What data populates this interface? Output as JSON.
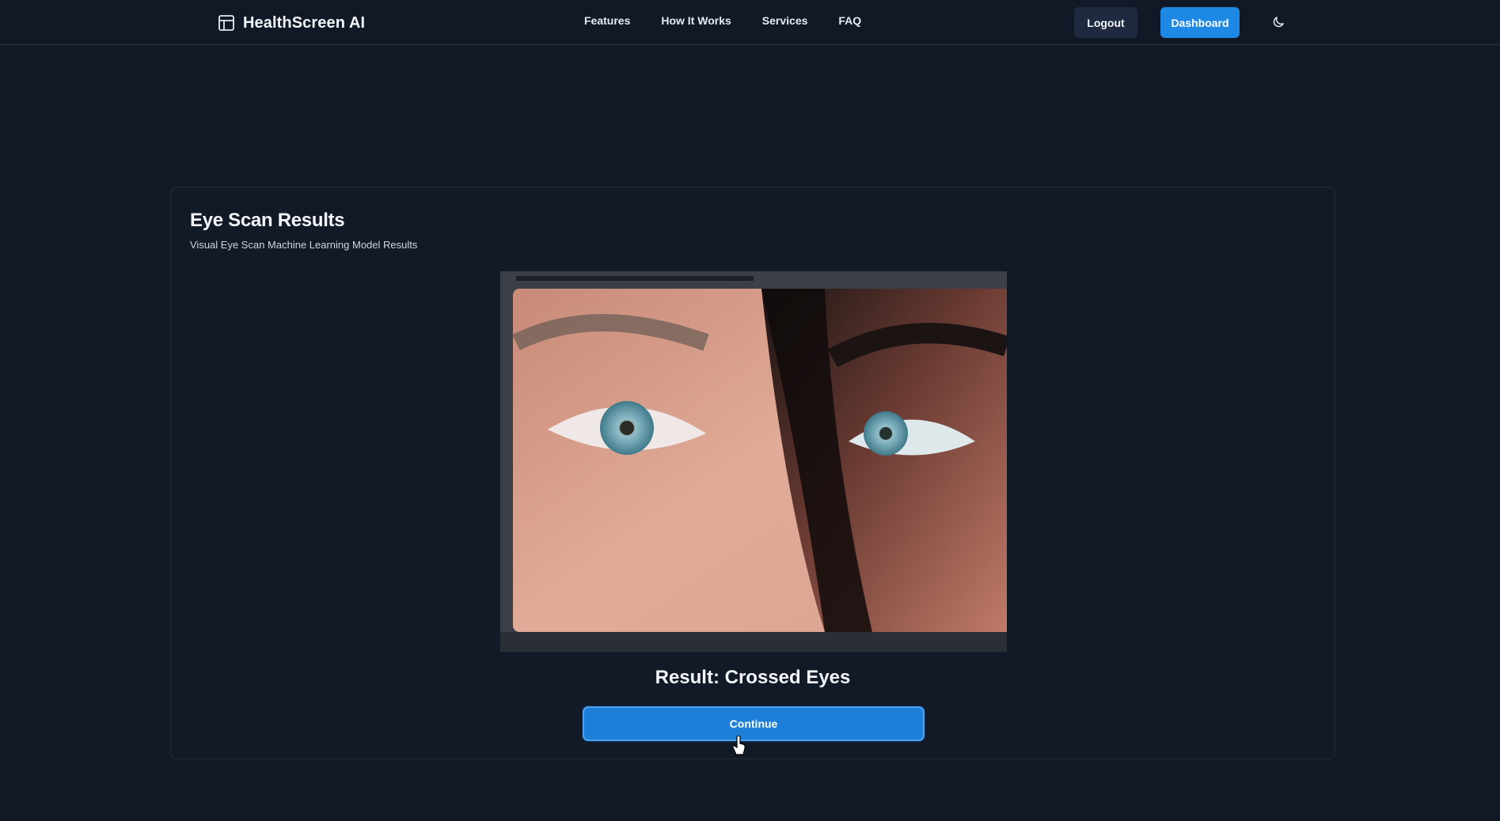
{
  "brand": {
    "name": "HealthScreen AI",
    "icon": "layout-icon"
  },
  "nav": {
    "links": [
      {
        "label": "Features"
      },
      {
        "label": "How It Works"
      },
      {
        "label": "Services"
      },
      {
        "label": "FAQ"
      }
    ],
    "logout_label": "Logout",
    "dashboard_label": "Dashboard",
    "theme_icon": "moon-icon"
  },
  "card": {
    "title": "Eye Scan Results",
    "subtitle": "Visual Eye Scan Machine Learning Model Results",
    "image_subject": "eye-scan-photo",
    "result": "Result: Crossed Eyes",
    "continue_label": "Continue"
  },
  "colors": {
    "background": "#121926",
    "accent": "#1e88e5",
    "logout_bg": "#1f2a40"
  }
}
